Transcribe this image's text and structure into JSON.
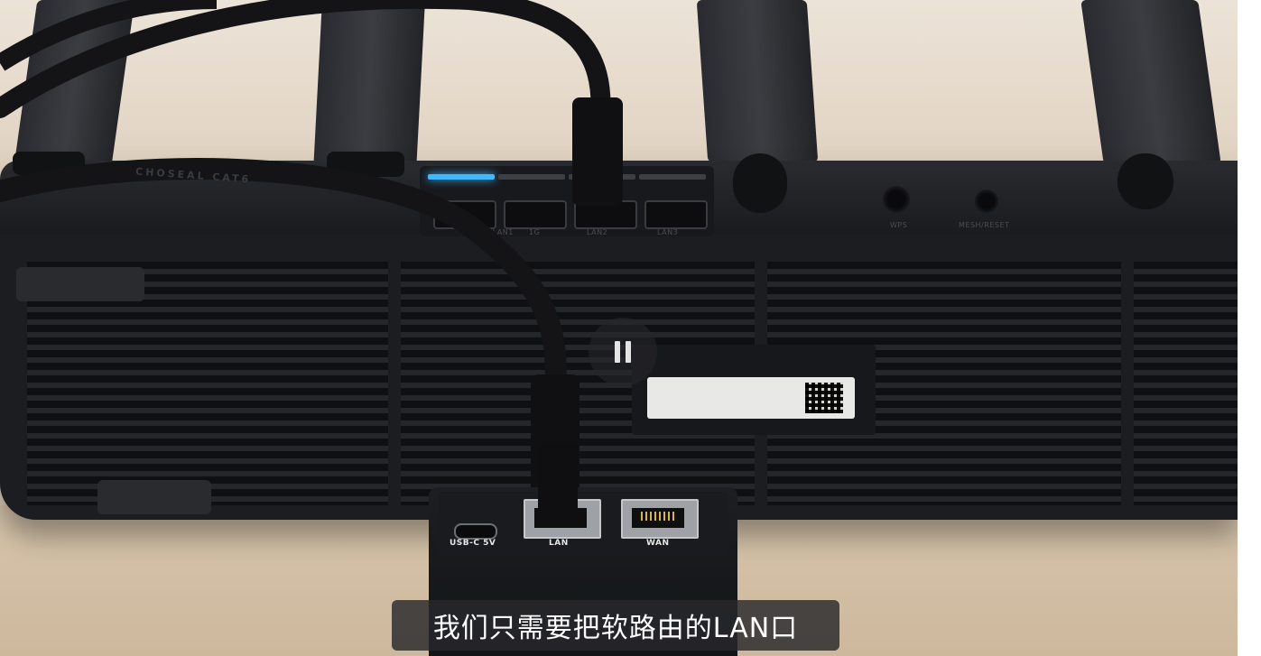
{
  "video": {
    "subtitle": "我们只需要把软路由的LAN口",
    "pause_glyph": "pause-icon",
    "colors": {
      "led_active": "#3fb8ff",
      "subtitle_bg": "#28282c"
    }
  },
  "scene": {
    "router_port_labels": [
      "WAN/LAN1",
      "1G",
      "LAN2",
      "LAN3"
    ],
    "router_button_labels": [
      "WPS",
      "MESH/RESET"
    ],
    "cable_print": "CHOSEAL CAT6",
    "softrouter_ports": {
      "usbc": "USB-C 5V",
      "lan": "LAN",
      "wan": "WAN"
    }
  }
}
